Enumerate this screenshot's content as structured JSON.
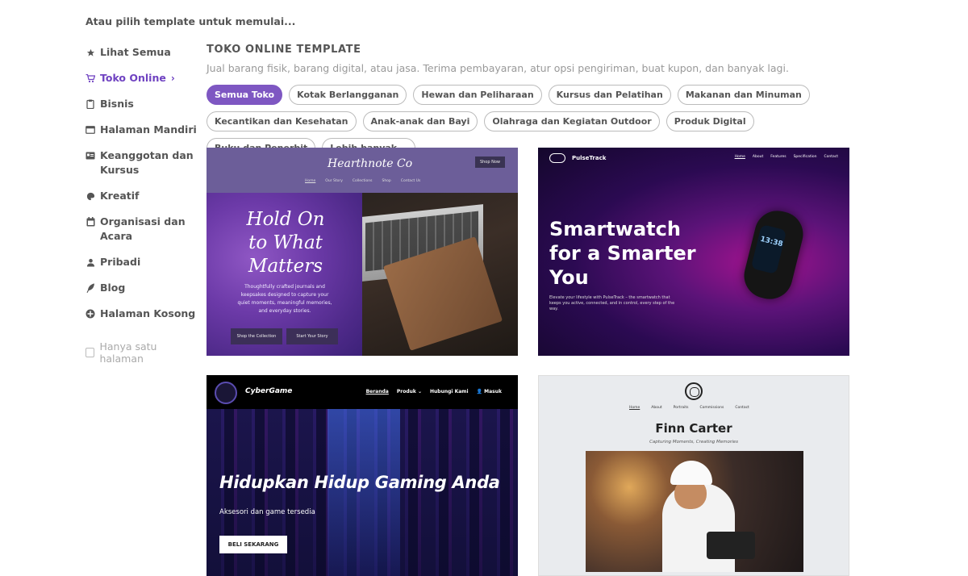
{
  "page": {
    "heading": "Atau pilih template untuk memulai..."
  },
  "sidebar": {
    "items": [
      {
        "label": "Lihat Semua",
        "icon": "star-icon"
      },
      {
        "label": "Toko Online",
        "icon": "cart-icon",
        "active": true,
        "chevron": "›"
      },
      {
        "label": "Bisnis",
        "icon": "clipboard-icon"
      },
      {
        "label": "Halaman Mandiri",
        "icon": "window-icon"
      },
      {
        "label": "Keanggotan dan Kursus",
        "icon": "id-card-icon"
      },
      {
        "label": "Kreatif",
        "icon": "palette-icon"
      },
      {
        "label": "Organisasi dan Acara",
        "icon": "calendar-icon"
      },
      {
        "label": "Pribadi",
        "icon": "user-icon"
      },
      {
        "label": "Blog",
        "icon": "feather-icon"
      },
      {
        "label": "Halaman Kosong",
        "icon": "plus-circle-icon"
      }
    ],
    "single_page_label": "Hanya satu halaman",
    "active_color": "#6f42c1"
  },
  "main": {
    "section_title": "TOKO ONLINE TEMPLATE",
    "section_desc": "Jual barang fisik, barang digital, atau jasa. Terima pembayaran, atur opsi pengiriman, buat kupon, dan banyak lagi.",
    "chips": [
      {
        "label": "Semua Toko",
        "active": true
      },
      {
        "label": "Kotak Berlangganan"
      },
      {
        "label": "Hewan dan Peliharaan"
      },
      {
        "label": "Kursus dan Pelatihan"
      },
      {
        "label": "Makanan dan Minuman"
      },
      {
        "label": "Kecantikan dan Kesehatan"
      },
      {
        "label": "Anak-anak dan Bayi"
      },
      {
        "label": "Olahraga dan Kegiatan Outdoor"
      },
      {
        "label": "Produk Digital"
      },
      {
        "label": "Buku dan Penerbit"
      },
      {
        "label": "Lebih banyak..."
      }
    ],
    "chip_active_color": "#7e57c2"
  },
  "templates": {
    "hearthnote": {
      "brand": "Hearthnote Co",
      "shop_now": "Shop Now",
      "links": [
        "Home",
        "Our Story",
        "Collections",
        "Shop",
        "Contact Us"
      ],
      "hero": "Hold On to What Matters",
      "desc": "Thoughtfully crafted journals and keepsakes designed to capture your quiet moments, meaningful memories, and everyday stories.",
      "btn1": "Shop the Collection",
      "btn2": "Start Your Story"
    },
    "pulsetrack": {
      "brand": "PulseTrack",
      "links": [
        "Home",
        "About",
        "Features",
        "Specification",
        "Contact"
      ],
      "hero": "Smartwatch for a Smarter You",
      "desc": "Elevate your lifestyle with PulseTrack – the smartwatch that keeps you active, connected, and in control, every step of the way.",
      "watch_time": "13:38"
    },
    "cybergame": {
      "brand": "CyberGame",
      "links": [
        "Beranda",
        "Produk ⌄",
        "Hubungi Kami",
        "👤 Masuk"
      ],
      "hero": "Hidupkan Hidup Gaming Anda",
      "sub": "Aksesori dan game tersedia",
      "btn": "BELI SEKARANG"
    },
    "finn": {
      "links": [
        "Home",
        "About",
        "Portraits",
        "Commissions",
        "Contact"
      ],
      "name": "Finn Carter",
      "tagline": "Capturing Moments, Creating Memories"
    }
  }
}
